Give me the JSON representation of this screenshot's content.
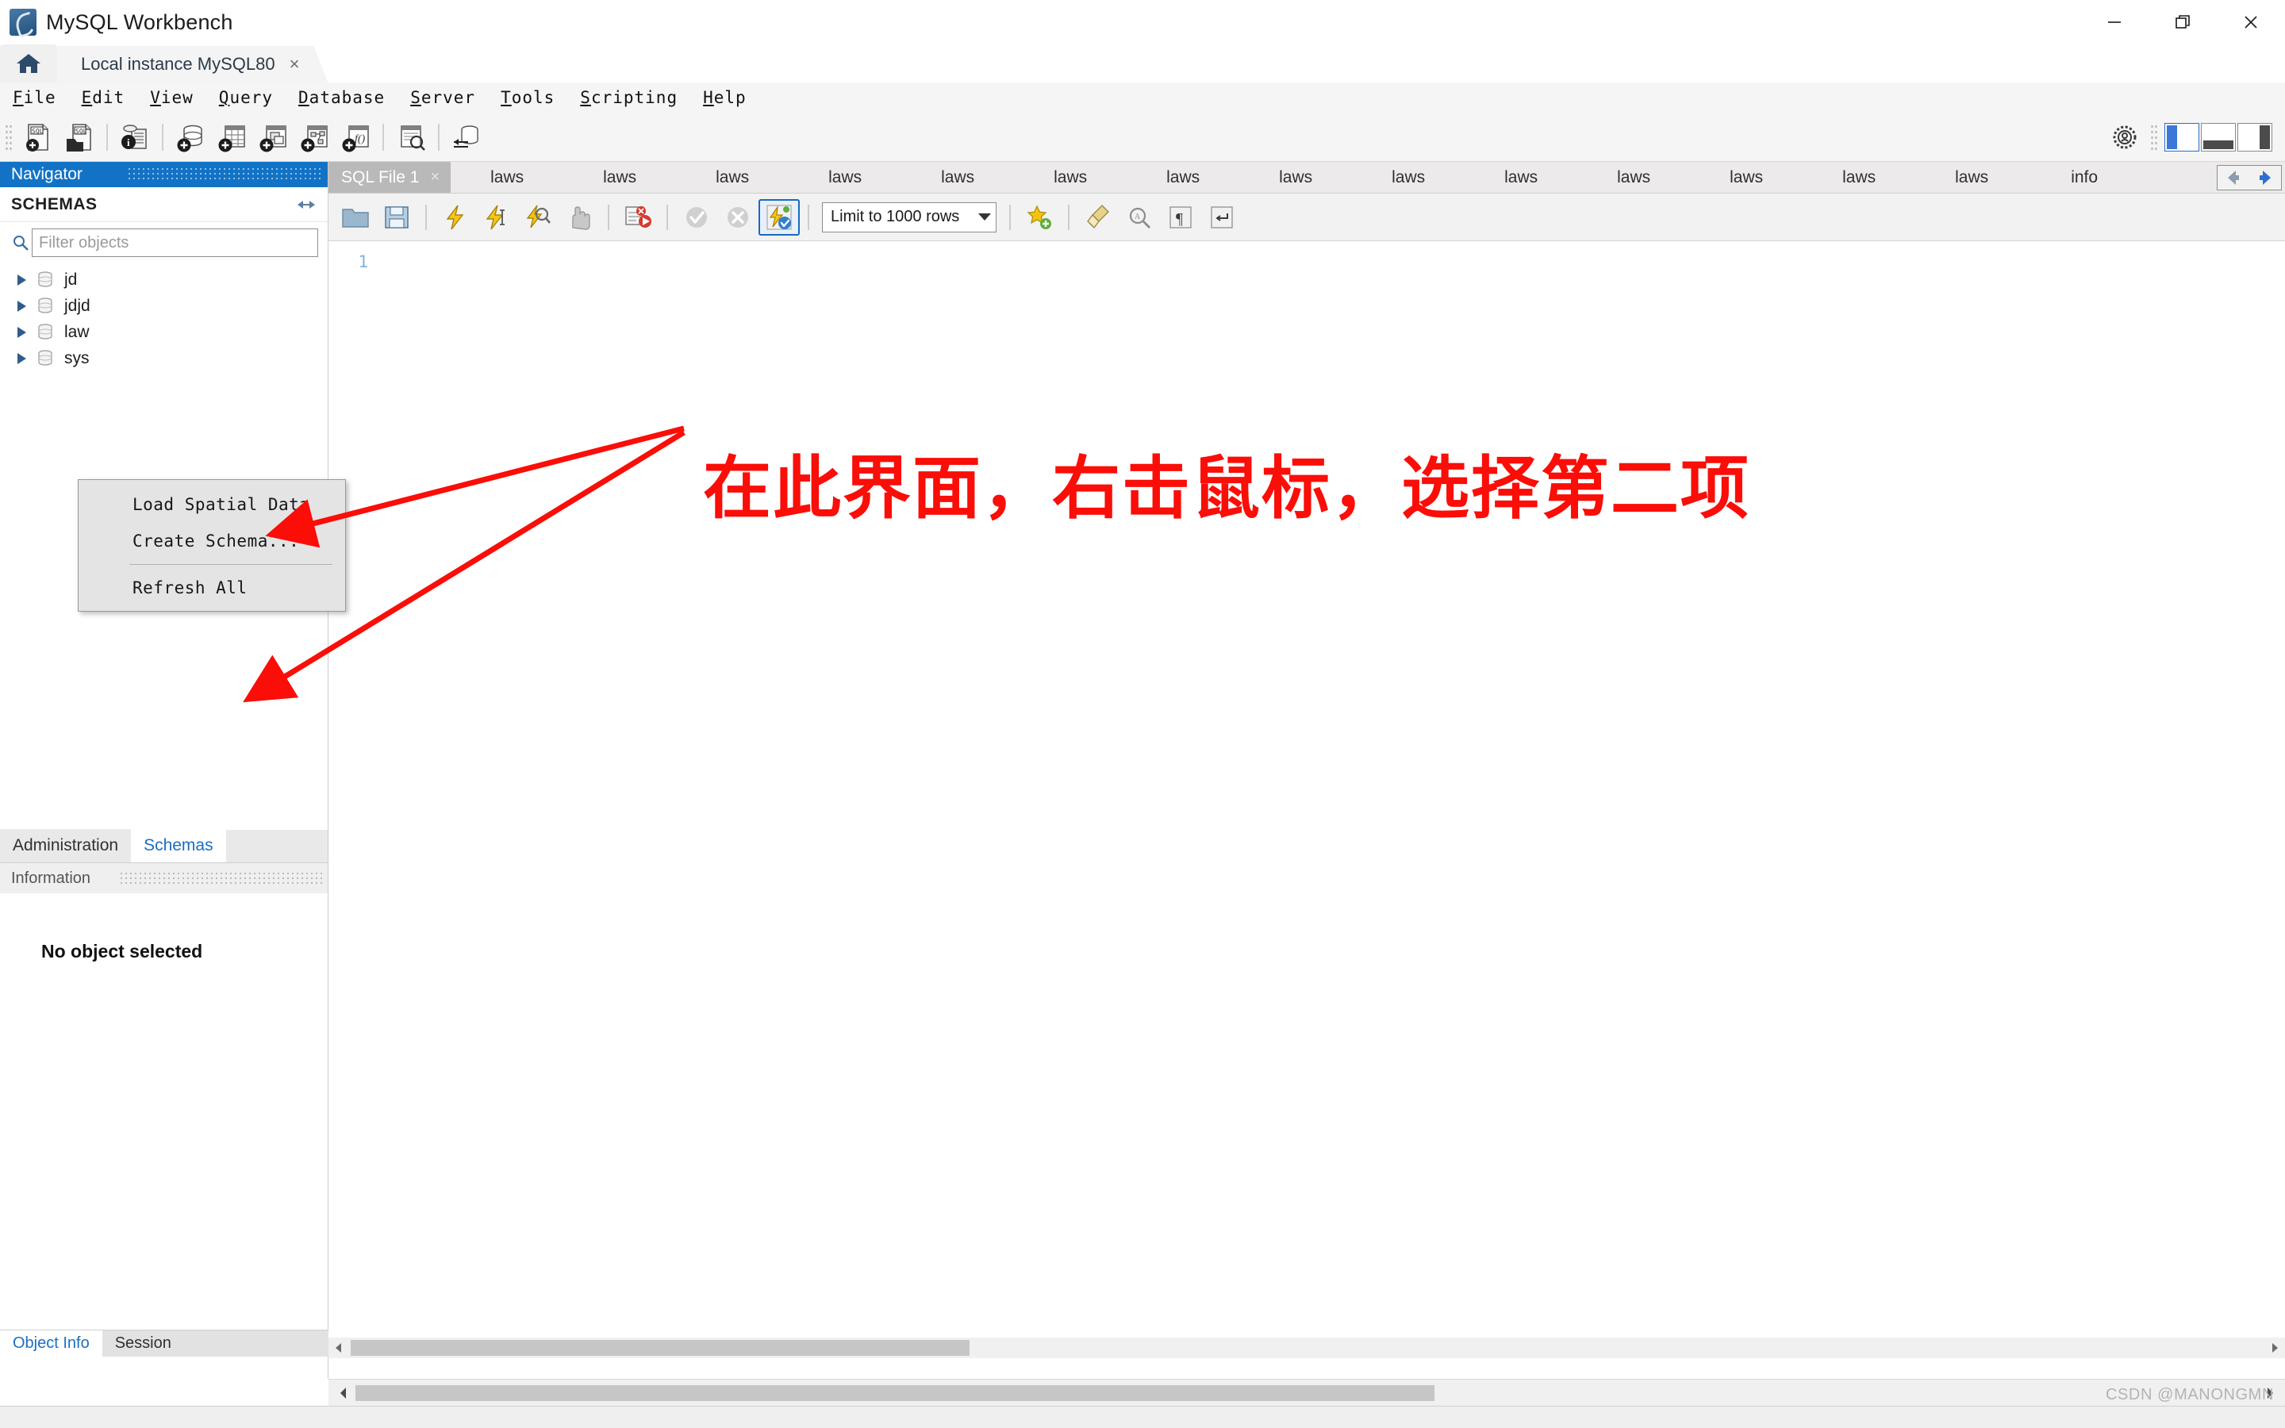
{
  "window": {
    "title": "MySQL Workbench",
    "app_icon": "mysql-dolphin-icon",
    "controls": {
      "minimize": "minimize-icon",
      "restore": "restore-icon",
      "close": "close-icon"
    }
  },
  "connection_tabs": {
    "home_icon": "home-icon",
    "active": {
      "label": "Local instance MySQL80",
      "close": "×"
    }
  },
  "menubar": {
    "items": [
      {
        "accel": "F",
        "rest": "ile"
      },
      {
        "accel": "E",
        "rest": "dit"
      },
      {
        "accel": "V",
        "rest": "iew"
      },
      {
        "accel": "Q",
        "rest": "uery"
      },
      {
        "accel": "D",
        "rest": "atabase"
      },
      {
        "accel": "S",
        "rest": "erver"
      },
      {
        "accel": "T",
        "rest": "ools"
      },
      {
        "accel": "S",
        "rest": "cripting"
      },
      {
        "accel": "H",
        "rest": "elp"
      }
    ]
  },
  "main_toolbar": {
    "buttons": [
      "new-sql-tab-icon",
      "open-sql-script-icon",
      "connection-info-icon",
      "new-schema-icon",
      "new-table-icon",
      "new-view-icon",
      "new-procedure-icon",
      "new-function-icon",
      "search-data-icon",
      "reconnect-server-icon"
    ],
    "right": {
      "settings_icon": "gear-icon",
      "panels": [
        "toggle-sidebar-icon",
        "toggle-output-panel-icon",
        "toggle-secondary-sidebar-icon"
      ]
    }
  },
  "navigator": {
    "header": "Navigator",
    "schemas_title": "SCHEMAS",
    "refresh_icon": "refresh-schemas-icon",
    "search_icon": "search-icon",
    "filter": {
      "value": "",
      "placeholder": "Filter objects"
    },
    "schemas": [
      {
        "name": "jd",
        "icon": "database-icon"
      },
      {
        "name": "jdjd",
        "icon": "database-icon"
      },
      {
        "name": "law",
        "icon": "database-icon"
      },
      {
        "name": "sys",
        "icon": "database-icon"
      }
    ],
    "tabs": [
      {
        "label": "Administration",
        "active": false
      },
      {
        "label": "Schemas",
        "active": true
      }
    ],
    "information": {
      "header": "Information",
      "empty_text": "No object selected"
    },
    "bottom_tabs": [
      {
        "label": "Object Info",
        "active": true
      },
      {
        "label": "Session",
        "active": false
      }
    ]
  },
  "context_menu": {
    "items": [
      {
        "label": "Load Spatial Data",
        "separator_after": false
      },
      {
        "label": "Create Schema...",
        "separator_after": true
      },
      {
        "label": "Refresh All",
        "separator_after": false
      }
    ]
  },
  "editor": {
    "tabs": [
      {
        "label": "SQL File 1",
        "active": true,
        "close": "×"
      },
      {
        "label": "laws",
        "active": false
      },
      {
        "label": "laws",
        "active": false
      },
      {
        "label": "laws",
        "active": false
      },
      {
        "label": "laws",
        "active": false
      },
      {
        "label": "laws",
        "active": false
      },
      {
        "label": "laws",
        "active": false
      },
      {
        "label": "laws",
        "active": false
      },
      {
        "label": "laws",
        "active": false
      },
      {
        "label": "laws",
        "active": false
      },
      {
        "label": "laws",
        "active": false
      },
      {
        "label": "laws",
        "active": false
      },
      {
        "label": "laws",
        "active": false
      },
      {
        "label": "laws",
        "active": false
      },
      {
        "label": "laws",
        "active": false
      },
      {
        "label": "info",
        "active": false
      }
    ],
    "tab_scroll": {
      "left": "scroll-left-icon",
      "right": "scroll-right-icon"
    },
    "toolbar": {
      "buttons": [
        "open-script-icon",
        "save-script-icon",
        "execute-statement-icon",
        "execute-current-statement-icon",
        "explain-query-icon",
        "stop-query-icon",
        "toggle-stop-on-error-icon",
        "commit-transaction-icon",
        "rollback-transaction-icon",
        "toggle-autocommit-icon"
      ],
      "limit_label": "Limit to 1000 rows",
      "right_buttons": [
        "save-snippet-icon",
        "beautify-query-icon",
        "find-icon",
        "show-invisible-characters-icon",
        "wrap-long-lines-icon"
      ]
    },
    "line_numbers": [
      "1"
    ],
    "content": ""
  },
  "annotation": {
    "text": "在此界面，右击鼠标，选择第二项",
    "color": "#fb0d08",
    "arrows": 2
  },
  "watermark": "CSDN @MANONGMN",
  "colors": {
    "navigator_header": "#1273c6",
    "active_tab_link": "#1a6fc4",
    "annotation_red": "#fb0d08",
    "toolbar_bg": "#f5f5f5",
    "editor_tab_active": "#b9b9b9"
  }
}
